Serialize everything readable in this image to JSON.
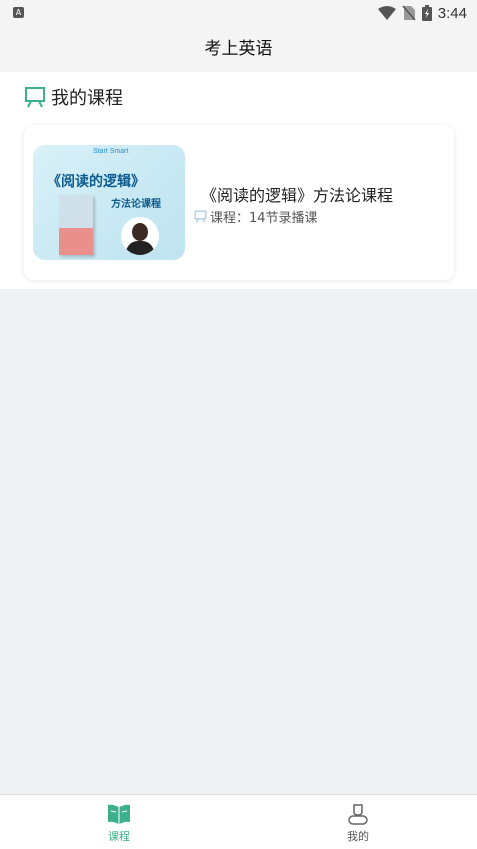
{
  "status_bar": {
    "time": "3:44",
    "notification_icon_letter": "A"
  },
  "header": {
    "title": "考上英语"
  },
  "section": {
    "title": "我的课程",
    "icon": "presentation-board-icon"
  },
  "courses": [
    {
      "title": "《阅读的逻辑》方法论课程",
      "subtitle": "课程：14节录播课",
      "thumbnail": {
        "brand": "Start Smart",
        "headline": "《阅读的逻辑》",
        "tagline": "方法论课程"
      }
    }
  ],
  "tabbar": {
    "tabs": [
      {
        "label": "课程",
        "icon": "open-book-icon",
        "active": true
      },
      {
        "label": "我的",
        "icon": "user-icon",
        "active": false
      }
    ],
    "active_color": "#3cb08a",
    "inactive_color": "#555555"
  },
  "colors": {
    "accent": "#3cb08a",
    "background": "#f0f1f5"
  }
}
